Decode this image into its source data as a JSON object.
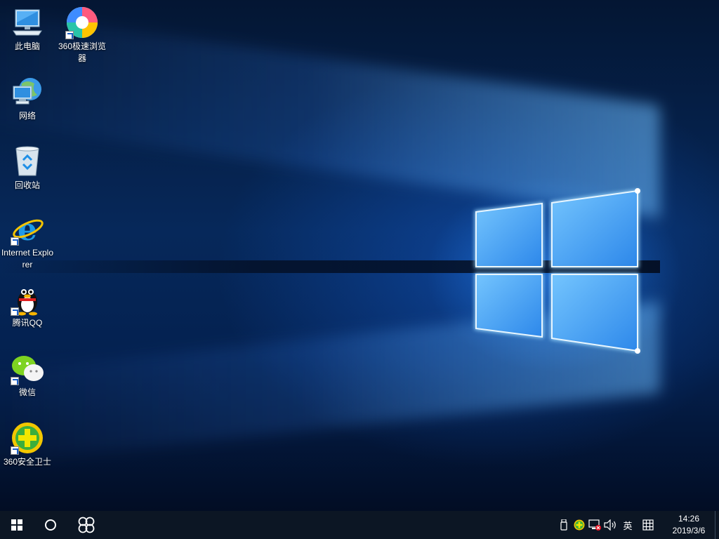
{
  "desktop": {
    "icons": [
      {
        "label": "此电脑"
      },
      {
        "label": "360极速浏览器"
      },
      {
        "label": "网络"
      },
      {
        "label": "回收站"
      },
      {
        "label": "Internet Explorer"
      },
      {
        "label": "腾讯QQ"
      },
      {
        "label": "微信"
      },
      {
        "label": "360安全卫士"
      }
    ]
  },
  "taskbar": {
    "start_icon": "windows-start-icon",
    "search_icon": "cortana-circle-icon",
    "app_icon": "360-speed-browser-icon",
    "tray": {
      "usb_icon": "usb-drive-icon",
      "guard_icon": "360-guard-icon",
      "network_icon": "network-disconnected-icon",
      "volume_icon": "speaker-icon",
      "ime_label": "英",
      "ime_mode_icon": "ime-grid-icon"
    },
    "clock": {
      "time": "14:26",
      "date": "2019/3/6"
    }
  },
  "colors": {
    "taskbar": "#0c1624",
    "accent_blue": "#2b8cff"
  }
}
